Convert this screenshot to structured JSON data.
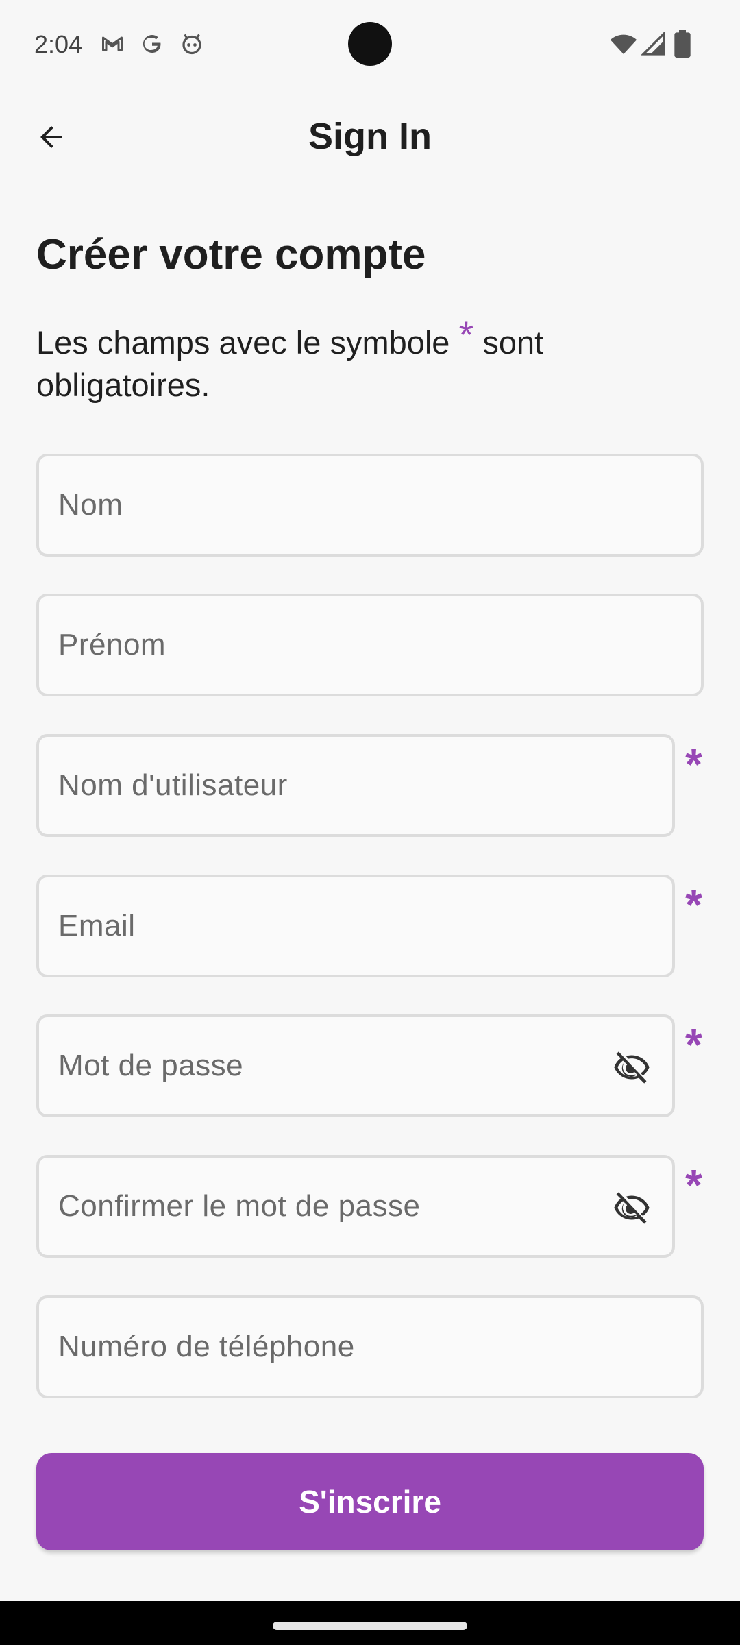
{
  "status_bar": {
    "time": "2:04",
    "left_icons": [
      "gmail-icon",
      "google-icon",
      "robot-icon"
    ],
    "right_icons": [
      "wifi-icon",
      "cell-signal-icon",
      "battery-icon"
    ]
  },
  "app_bar": {
    "title": "Sign In",
    "back_icon": "arrow-back-icon"
  },
  "form": {
    "heading": "Créer votre compte",
    "note_before": "Les champs avec le symbole ",
    "note_symbol": "*",
    "note_after": " sont obligatoires.",
    "fields": [
      {
        "placeholder": "Nom",
        "required": false,
        "value": ""
      },
      {
        "placeholder": "Prénom",
        "required": false,
        "value": ""
      },
      {
        "placeholder": "Nom d'utilisateur",
        "required": true,
        "value": ""
      },
      {
        "placeholder": "Email",
        "required": true,
        "value": ""
      },
      {
        "placeholder": "Mot de passe",
        "required": true,
        "value": "",
        "trailing_icon": "visibility-off-icon"
      },
      {
        "placeholder": "Confirmer le mot de passe",
        "required": true,
        "value": "",
        "trailing_icon": "visibility-off-icon"
      },
      {
        "placeholder": "Numéro de téléphone",
        "required": false,
        "value": ""
      }
    ],
    "required_marker": "*",
    "submit_label": "S'inscrire"
  },
  "colors": {
    "accent": "#9747b5",
    "background": "#f7f7f7",
    "field_border": "#dcdcdc",
    "text": "#1f1f1f"
  }
}
